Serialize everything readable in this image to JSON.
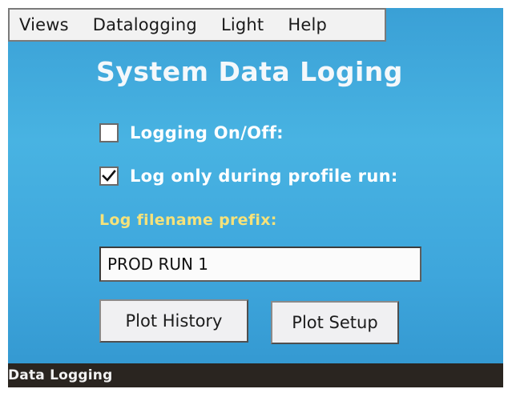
{
  "menu": {
    "items": [
      {
        "label": "Views"
      },
      {
        "label": "Datalogging"
      },
      {
        "label": "Light"
      },
      {
        "label": "Help"
      }
    ]
  },
  "page": {
    "title": "System Data Loging"
  },
  "options": {
    "logging": {
      "label": "Logging On/Off:",
      "checked": false
    },
    "profile_run": {
      "label": "Log only during profile run:",
      "checked": true
    }
  },
  "filename": {
    "label": "Log filename prefix:",
    "value": "PROD RUN 1"
  },
  "buttons": {
    "plot_history": "Plot History",
    "plot_setup": "Plot Setup"
  },
  "status": {
    "text": "Data Logging"
  },
  "colors": {
    "background": "#3ea6dc",
    "title_text": "#f4f8fb",
    "prefix_label": "#f5e27a",
    "status_bar": "#2a2520"
  }
}
